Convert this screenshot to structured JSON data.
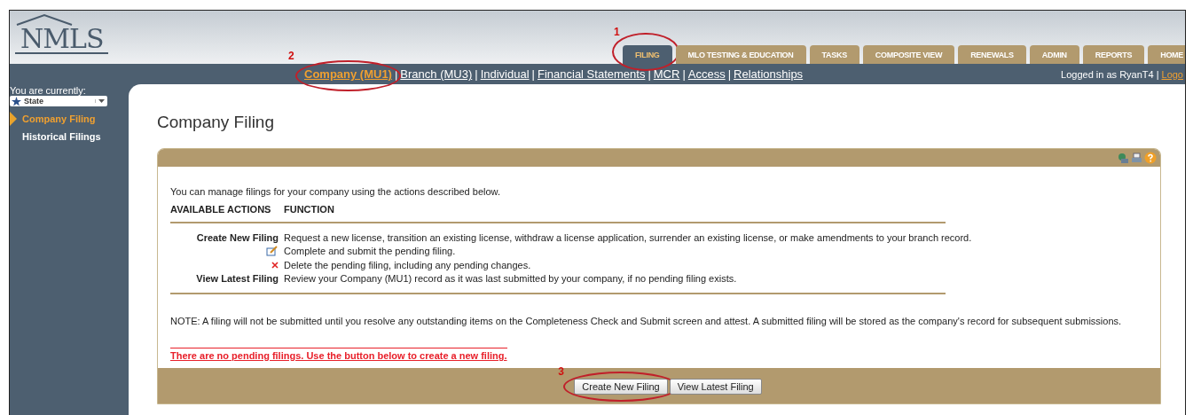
{
  "logo": {
    "text": "NMLS"
  },
  "tabs": [
    {
      "label": "FILING",
      "selected": true,
      "callout": "1"
    },
    {
      "label": "MLO TESTING & EDUCATION",
      "selected": false
    },
    {
      "label": "TASKS",
      "selected": false
    },
    {
      "label": "COMPOSITE VIEW",
      "selected": false
    },
    {
      "label": "RENEWALS",
      "selected": false
    },
    {
      "label": "ADMIN",
      "selected": false
    },
    {
      "label": "REPORTS",
      "selected": false
    },
    {
      "label": "HOME",
      "selected": false
    }
  ],
  "subnav_separator": "|",
  "subnav": [
    {
      "label": "Company (MU1)",
      "selected": true,
      "callout": "2"
    },
    {
      "label": "Branch (MU3)",
      "selected": false
    },
    {
      "label": "Individual",
      "selected": false
    },
    {
      "label": "Financial Statements",
      "selected": false
    },
    {
      "label": "MCR",
      "selected": false
    },
    {
      "label": "Access",
      "selected": false
    },
    {
      "label": "Relationships",
      "selected": false
    }
  ],
  "user": {
    "text": "Logged in as RyanT4",
    "separator": "|",
    "link": "Logo"
  },
  "sidebar": {
    "label": "You are currently:",
    "select": "State",
    "items": [
      {
        "label": "Company Filing",
        "selected": true
      },
      {
        "label": "Historical Filings",
        "selected": false
      }
    ]
  },
  "page_title": "Company Filing",
  "intro": "You can manage filings for your company using the actions described below.",
  "columns": [
    "AVAILABLE ACTIONS",
    "FUNCTION"
  ],
  "actions": [
    {
      "kind": "text",
      "action": "Create New Filing",
      "function": "Request a new license, transition an existing license, withdraw a license application, surrender an existing license, or make amendments to your branch record."
    },
    {
      "kind": "edit",
      "function": "Complete and submit the pending filing."
    },
    {
      "kind": "delete",
      "function": "Delete the pending filing, including any pending changes."
    },
    {
      "kind": "text",
      "action": "View Latest Filing",
      "function": "Review your Company (MU1) record as it was last submitted by your company, if no pending filing exists."
    }
  ],
  "note": "NOTE: A filing will not be submitted until you resolve any outstanding items on the Completeness Check and Submit screen and attest. A submitted filing will be stored as the company's record for subsequent submissions.",
  "alert": "There are no pending filings. Use the button below to create a new filing.",
  "buttons": [
    {
      "label": "Create New Filing",
      "callout": "3"
    },
    {
      "label": "View Latest Filing"
    }
  ]
}
